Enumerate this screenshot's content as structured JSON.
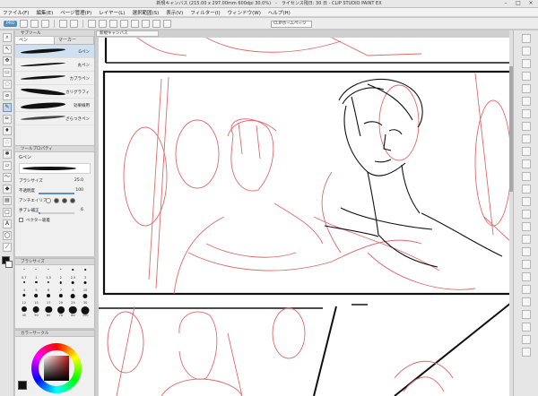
{
  "window": {
    "title": "新規キャンバス (215.00 x 297.00mm 600dpi 30.0%)　-　ライセンス残日: 30 日 - CLIP STUDIO PAINT EX",
    "minimize": "–",
    "maximize": "□",
    "close": "×"
  },
  "menu": [
    "ファイル(F)",
    "編集(E)",
    "ページ管理(P)",
    "レイヤー(L)",
    "選択範囲(S)",
    "表示(V)",
    "フィルター(I)",
    "ウィンドウ(W)",
    "ヘルプ(H)"
  ],
  "command_bar": {
    "tag": "PRO",
    "home": "CLIPホームページ"
  },
  "canvas": {
    "document_tab": "新規キャンバス"
  },
  "sub_tool": {
    "header": "サブツール",
    "tabs": [
      "ペン",
      "マーカー"
    ],
    "brushes": [
      "Gペン",
      "丸ペン",
      "カブラペン",
      "カリグラフィ",
      "効果線用",
      "ざらつきペン"
    ],
    "selected_index": 0
  },
  "tool_property": {
    "header": "ツールプロパティ",
    "title": "Gペン",
    "brush_size_label": "ブラシサイズ",
    "brush_size_value": "25.0",
    "opacity_label": "不透明度",
    "opacity_value": "100",
    "opacity_fraction": 1.0,
    "antialias_label": "アンチエイリアス",
    "stabilization_label": "手ブレ補正",
    "stabilization_value": "6",
    "stabilization_fraction": 0.06,
    "vector_label": "ベクター吸着"
  },
  "brush_size": {
    "header": "ブラシサイズ",
    "sizes": [
      "0.7",
      "1",
      "1.5",
      "2",
      "2.5",
      "3",
      "4",
      "5",
      "6",
      "7",
      "8",
      "10",
      "12",
      "15",
      "17",
      "20",
      "25",
      "30",
      "40",
      "50",
      "60",
      "70",
      "80",
      "100"
    ]
  },
  "color_panel": {
    "header": "カラーサークル",
    "main_color": "#111111",
    "hue_color": "#c01818"
  },
  "colors": {
    "sketch_red": "#e06a6a",
    "ink": "#111111",
    "accent": "#4a90c8"
  }
}
